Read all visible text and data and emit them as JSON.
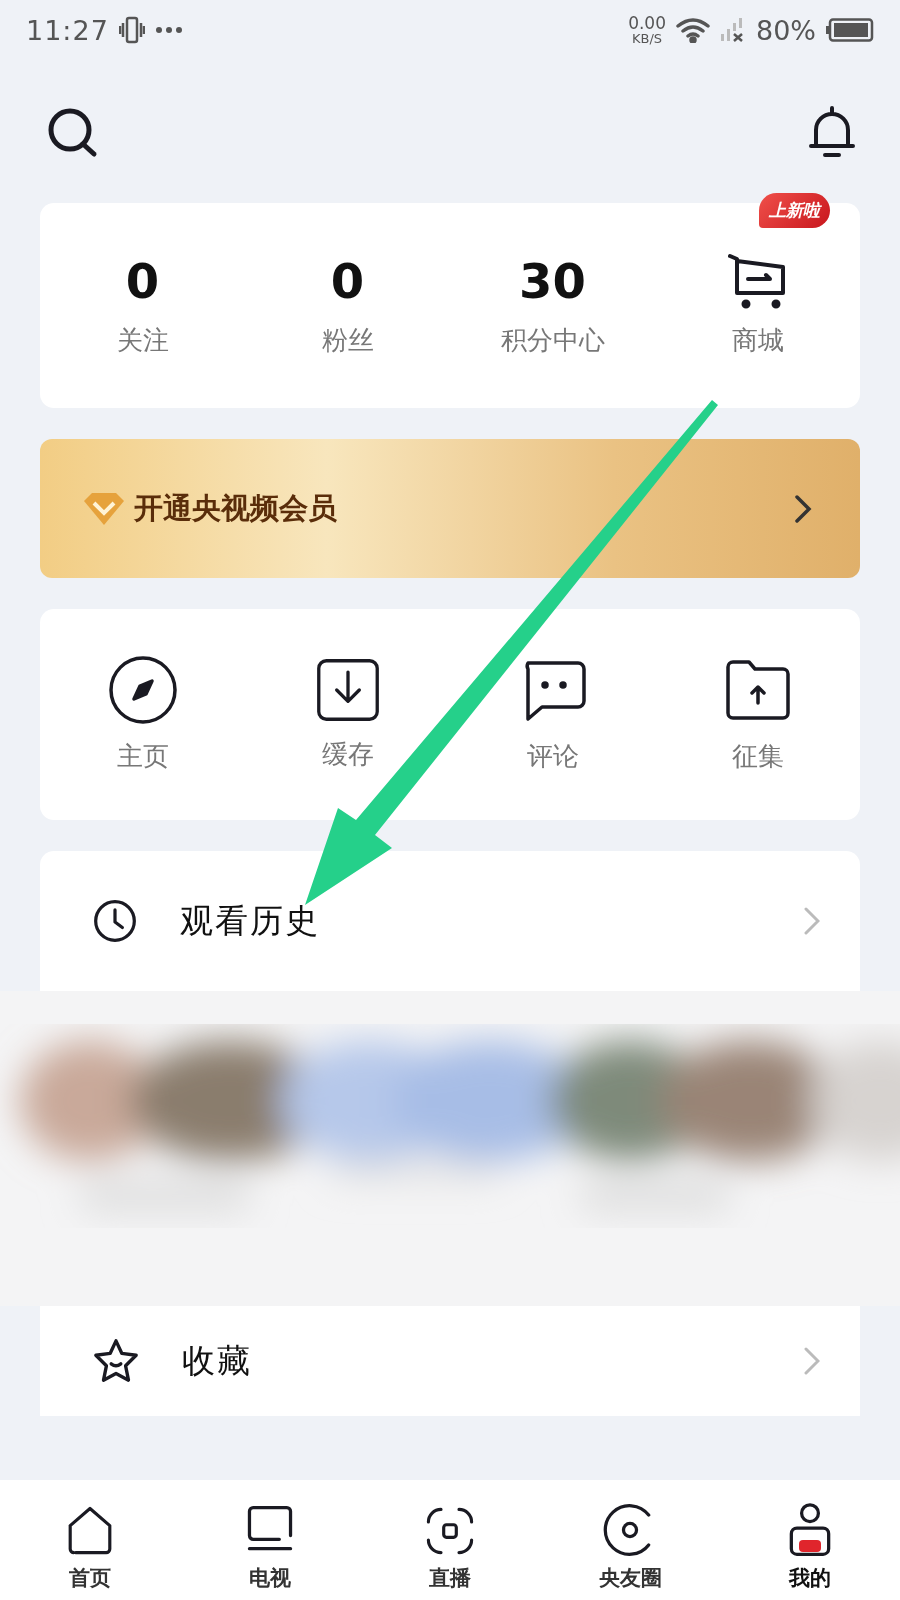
{
  "status_bar": {
    "time": "11:27",
    "net_speed": "0.00",
    "net_unit": "KB/S",
    "battery": "80%"
  },
  "stats": [
    {
      "kind": "count",
      "value": "0",
      "label": "关注"
    },
    {
      "kind": "count",
      "value": "0",
      "label": "粉丝"
    },
    {
      "kind": "count",
      "value": "30",
      "label": "积分中心"
    },
    {
      "kind": "shop",
      "label": "商城",
      "badge": "上新啦"
    }
  ],
  "vip_banner": {
    "label": "开通央视频会员"
  },
  "shortcuts": [
    {
      "label": "主页"
    },
    {
      "label": "缓存"
    },
    {
      "label": "评论"
    },
    {
      "label": "征集"
    }
  ],
  "menu": [
    {
      "label": "观看历史"
    },
    {
      "label": "收藏"
    }
  ],
  "nav": [
    {
      "label": "首页",
      "selected": false
    },
    {
      "label": "电视",
      "selected": false
    },
    {
      "label": "直播",
      "selected": false
    },
    {
      "label": "央友圈",
      "selected": false
    },
    {
      "label": "我的",
      "selected": true
    }
  ]
}
